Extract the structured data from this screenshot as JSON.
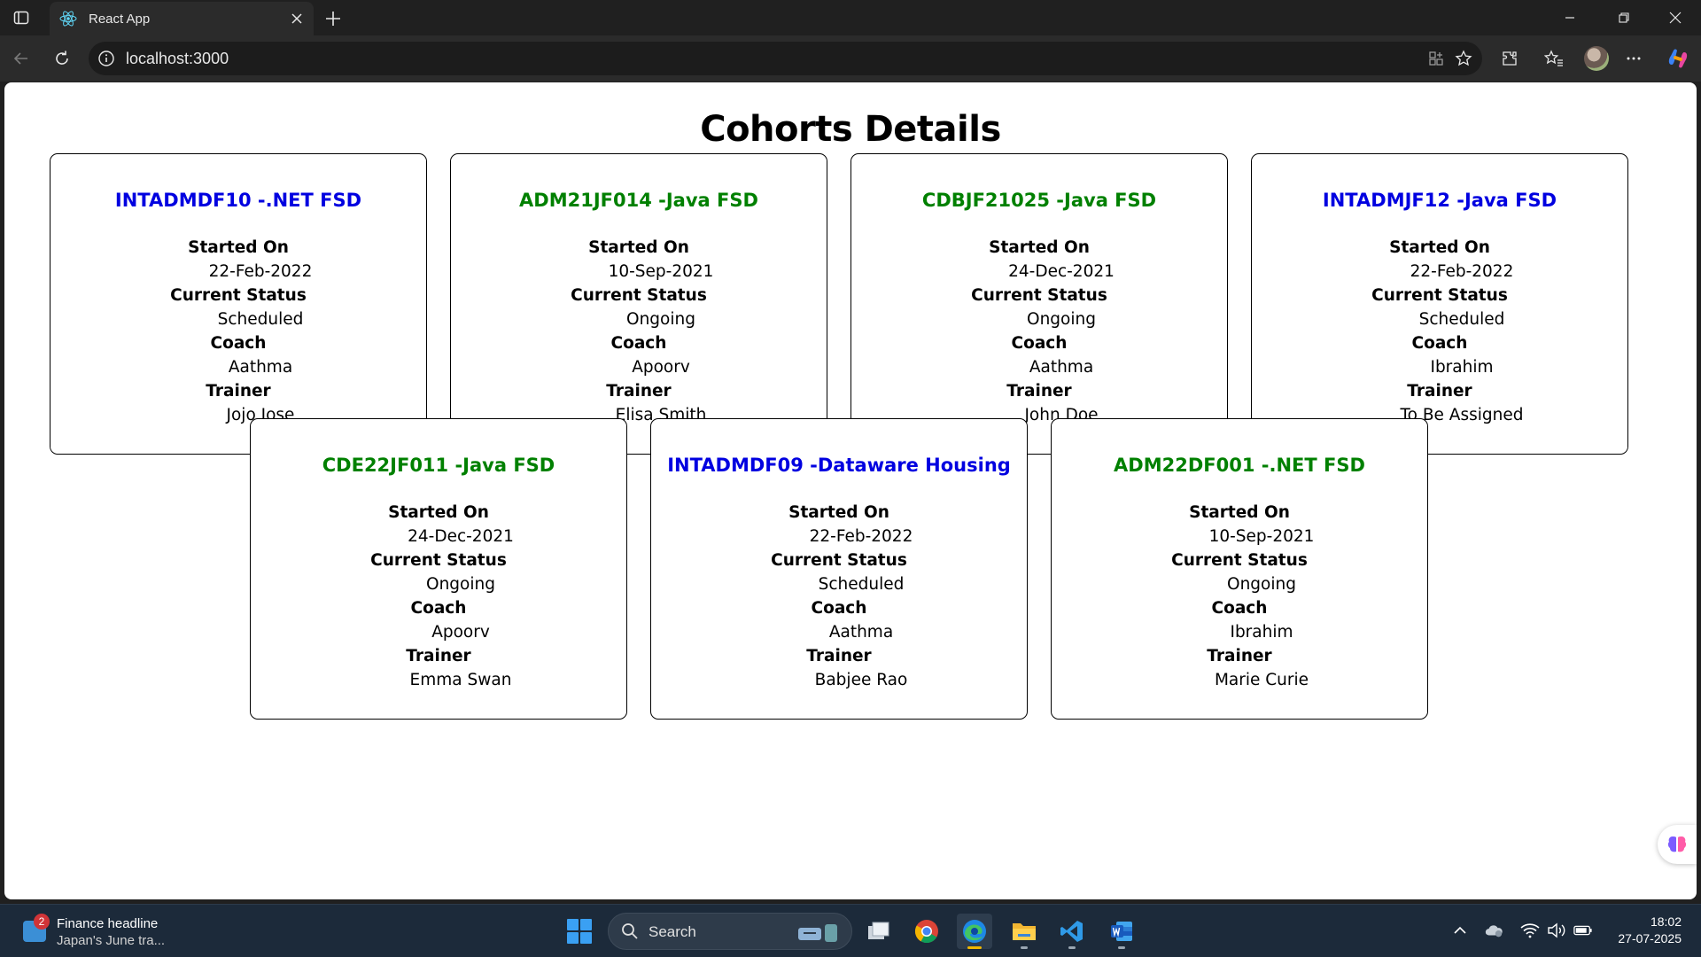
{
  "browser": {
    "tab_title": "React App",
    "url": "localhost:3000"
  },
  "page": {
    "heading": "Cohorts Details",
    "field_labels": {
      "started_on": "Started On",
      "current_status": "Current Status",
      "coach": "Coach",
      "trainer": "Trainer"
    },
    "title_colors": {
      "ongoing": "#008000",
      "scheduled": "#0000e0"
    },
    "cohorts": [
      {
        "title": "INTADMDF10 -.NET FSD",
        "started_on": "22-Feb-2022",
        "status": "Scheduled",
        "coach": "Aathma",
        "trainer": "Jojo Jose"
      },
      {
        "title": "ADM21JF014 -Java FSD",
        "started_on": "10-Sep-2021",
        "status": "Ongoing",
        "coach": "Apoorv",
        "trainer": "Elisa Smith"
      },
      {
        "title": "CDBJF21025 -Java FSD",
        "started_on": "24-Dec-2021",
        "status": "Ongoing",
        "coach": "Aathma",
        "trainer": "John Doe"
      },
      {
        "title": "INTADMJF12 -Java FSD",
        "started_on": "22-Feb-2022",
        "status": "Scheduled",
        "coach": "Ibrahim",
        "trainer": "To Be Assigned"
      },
      {
        "title": "CDE22JF011 -Java FSD",
        "started_on": "24-Dec-2021",
        "status": "Ongoing",
        "coach": "Apoorv",
        "trainer": "Emma Swan"
      },
      {
        "title": "INTADMDF09 -Dataware Housing",
        "started_on": "22-Feb-2022",
        "status": "Scheduled",
        "coach": "Aathma",
        "trainer": "Babjee Rao"
      },
      {
        "title": "ADM22DF001 -.NET FSD",
        "started_on": "10-Sep-2021",
        "status": "Ongoing",
        "coach": "Ibrahim",
        "trainer": "Marie Curie"
      }
    ]
  },
  "taskbar": {
    "news_badge": "2",
    "news_title": "Finance headline",
    "news_subtitle": "Japan's June tra...",
    "search_label": "Search",
    "time": "18:02",
    "date": "27-07-2025",
    "apps": [
      "task-view-icon",
      "chrome-icon",
      "edge-icon",
      "file-explorer-icon",
      "vscode-icon",
      "word-icon"
    ]
  }
}
